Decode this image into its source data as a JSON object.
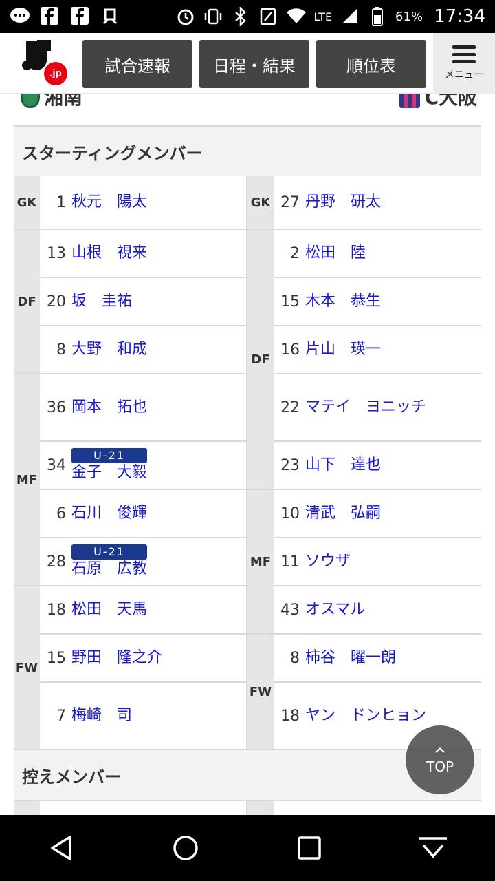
{
  "status_bar": {
    "battery": "61%",
    "time": "17:34",
    "network": "LTE"
  },
  "header": {
    "logo_text": ".jp",
    "nav": [
      "試合速報",
      "日程・結果",
      "順位表"
    ],
    "menu_label": "メニュー"
  },
  "teams": {
    "home": "湘南",
    "away": "C大阪"
  },
  "starting": {
    "title": "スターティングメンバー",
    "home": [
      {
        "pos": "GK",
        "num": "1",
        "name": "秋元　陽太",
        "badge": ""
      },
      {
        "pos": "DF",
        "num": "13",
        "name": "山根　視来",
        "badge": ""
      },
      {
        "pos": "DF",
        "num": "20",
        "name": "坂　圭祐",
        "badge": ""
      },
      {
        "pos": "DF",
        "num": "8",
        "name": "大野　和成",
        "badge": ""
      },
      {
        "pos": "MF",
        "num": "36",
        "name": "岡本　拓也",
        "badge": ""
      },
      {
        "pos": "MF",
        "num": "34",
        "name": "金子　大毅",
        "badge": "U-21"
      },
      {
        "pos": "MF",
        "num": "6",
        "name": "石川　俊輝",
        "badge": ""
      },
      {
        "pos": "MF",
        "num": "28",
        "name": "石原　広教",
        "badge": "U-21"
      },
      {
        "pos": "FW",
        "num": "18",
        "name": "松田　天馬",
        "badge": ""
      },
      {
        "pos": "FW",
        "num": "15",
        "name": "野田　隆之介",
        "badge": ""
      },
      {
        "pos": "FW",
        "num": "7",
        "name": "梅崎　司",
        "badge": ""
      }
    ],
    "away": [
      {
        "pos": "GK",
        "num": "27",
        "name": "丹野　研太"
      },
      {
        "pos": "DF",
        "num": "2",
        "name": "松田　陸"
      },
      {
        "pos": "DF",
        "num": "15",
        "name": "木本　恭生"
      },
      {
        "pos": "DF",
        "num": "16",
        "name": "片山　瑛一"
      },
      {
        "pos": "DF",
        "num": "22",
        "name": "マテイ　ヨニッチ"
      },
      {
        "pos": "DF",
        "num": "23",
        "name": "山下　達也"
      },
      {
        "pos": "MF",
        "num": "10",
        "name": "清武　弘嗣"
      },
      {
        "pos": "MF",
        "num": "11",
        "name": "ソウザ"
      },
      {
        "pos": "MF",
        "num": "43",
        "name": "オスマル"
      },
      {
        "pos": "FW",
        "num": "8",
        "name": "柿谷　曜一朗"
      },
      {
        "pos": "FW",
        "num": "18",
        "name": "ヤン　ドンヒョン"
      }
    ],
    "home_positions": [
      "GK",
      "DF",
      "MF",
      "FW"
    ],
    "away_positions": [
      "GK",
      "DF",
      "MF",
      "FW"
    ]
  },
  "bench": {
    "title": "控えメンバー"
  },
  "top_button": "TOP"
}
